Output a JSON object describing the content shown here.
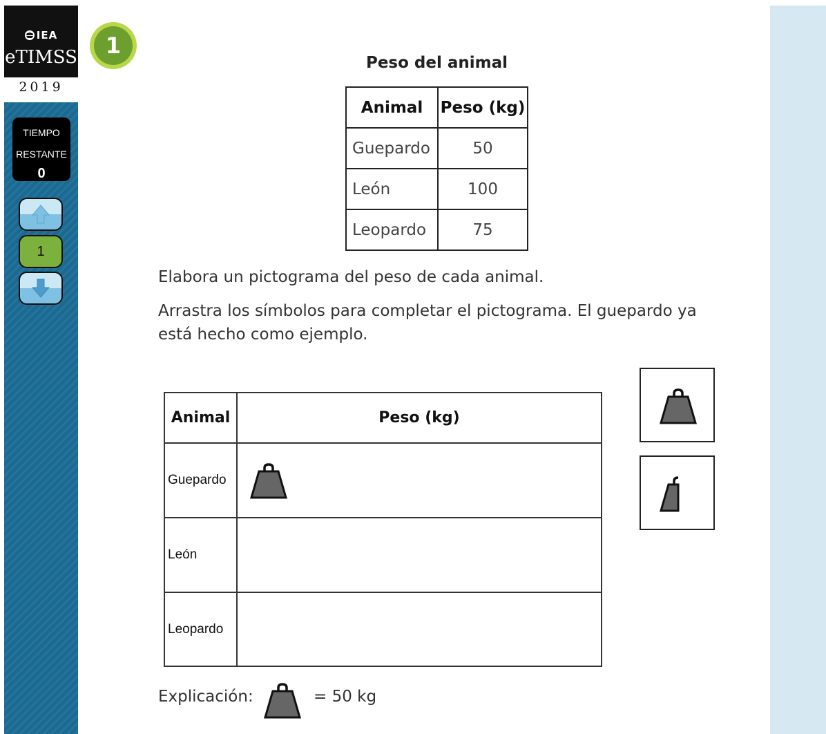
{
  "sidebar": {
    "logo_org": "IEA",
    "logo_brand": "eTIMSS",
    "logo_year": "2019",
    "timer_label_line1": "TIEMPO",
    "timer_label_line2": "RESTANTE",
    "timer_value": "0",
    "current_question": "1"
  },
  "question_number": "1",
  "data_table": {
    "title": "Peso del animal",
    "headers": [
      "Animal",
      "Peso (kg)"
    ],
    "rows": [
      {
        "animal": "Guepardo",
        "weight": "50"
      },
      {
        "animal": "León",
        "weight": "100"
      },
      {
        "animal": "Leopardo",
        "weight": "75"
      }
    ]
  },
  "instructions": {
    "line1": "Elabora un pictograma del peso de cada animal.",
    "line2a": "Arrastra los símbolos para completar el pictograma. El guepardo ya",
    "line2b": "está hecho como ejemplo."
  },
  "pictogram": {
    "headers": [
      "Animal",
      "Peso (kg)"
    ],
    "rows": [
      {
        "animal": "Guepardo",
        "full_symbols": 1
      },
      {
        "animal": "León",
        "full_symbols": 0
      },
      {
        "animal": "Leopardo",
        "full_symbols": 0
      }
    ]
  },
  "symbols": [
    "weight-full-icon",
    "weight-half-icon"
  ],
  "legend": {
    "label": "Explicación:",
    "value": "= 50 kg"
  },
  "colors": {
    "sidebar": "#1a6a93",
    "badge": "#6c9f2e",
    "right_panel": "#d6e9f3",
    "weight_symbol": "#666666"
  }
}
